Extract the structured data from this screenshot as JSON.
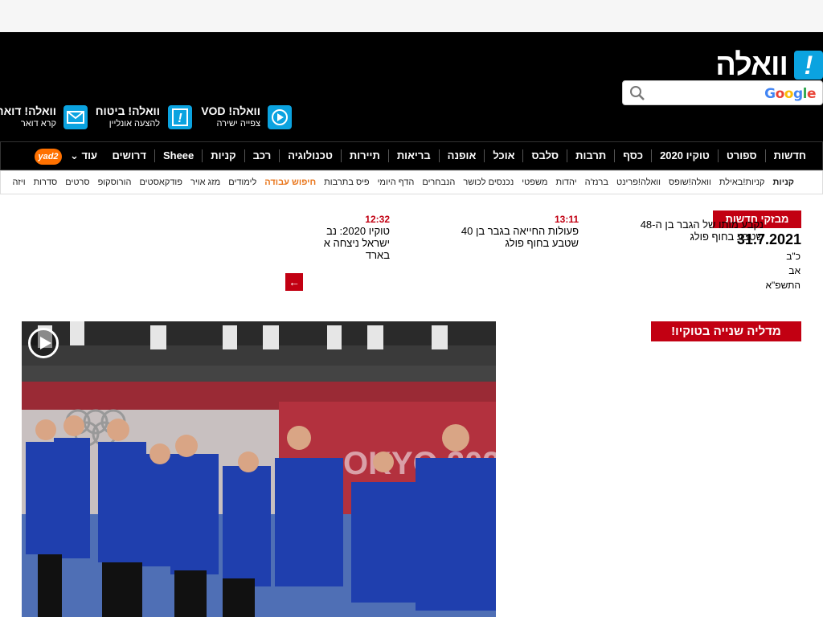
{
  "header": {
    "logo_text": "וואלה",
    "logo_mark": "!"
  },
  "search": {
    "placeholder": "",
    "brand": [
      "G",
      "o",
      "o",
      "g",
      "l",
      "e"
    ]
  },
  "services": [
    {
      "title": "וואלה! VOD",
      "subtitle": "צפייה ישירה",
      "icon": "play-circle-icon"
    },
    {
      "title": "וואלה! ביטוח",
      "subtitle": "להצעה אונליין",
      "icon": "insurance-icon"
    },
    {
      "title": "וואלה! דואר",
      "subtitle": "קרא דואר",
      "icon": "mail-icon"
    }
  ],
  "nav": {
    "items": [
      "חדשות",
      "ספורט",
      "טוקיו 2020",
      "כסף",
      "תרבות",
      "סלבס",
      "אוכל",
      "אופנה",
      "בריאות",
      "תיירות",
      "טכנולוגיה",
      "רכב",
      "קניות",
      "Sheee",
      "דרושים"
    ],
    "more": "עוד",
    "yad2": "yad2"
  },
  "subnav": {
    "items": [
      "קניות",
      "קניות!באילת",
      "וואלה!שופס",
      "וואלה!פרינט",
      "ברנז'ה",
      "יהדות",
      "משפטי",
      "נכנסים לכושר",
      "הנבחרים",
      "הדף היומי",
      "פיס בתרבות",
      "חיפוש עבודה",
      "לימודים",
      "מזג אויר",
      "פודקאסטים",
      "הורוסקופ",
      "סרטים",
      "סדרות",
      "ויזה"
    ]
  },
  "breaking": {
    "label": "מבזקי חדשות",
    "date": "31.7.2021",
    "heb_date_day": "כ\"ב",
    "heb_date_month": "אב",
    "heb_date_year": "התשפ\"א",
    "items": [
      {
        "time": "",
        "text": "נקבע מותו של הגבר בן ה-48 שטבע בחוף פולג"
      },
      {
        "time": "13:11",
        "text": "פעולות החייאה בגבר בן 40 שטבע בחוף פולג"
      },
      {
        "time": "12:32",
        "text": "טוקיו 2020: נב ישראל ניצחה א בארד"
      }
    ]
  },
  "section": {
    "title": "מדליה שנייה בטוקיו!"
  },
  "colors": {
    "accent_red": "#c20012",
    "brand_blue": "#0ba3e0",
    "header_bg": "#000000",
    "yad2_orange": "#ff7100"
  }
}
